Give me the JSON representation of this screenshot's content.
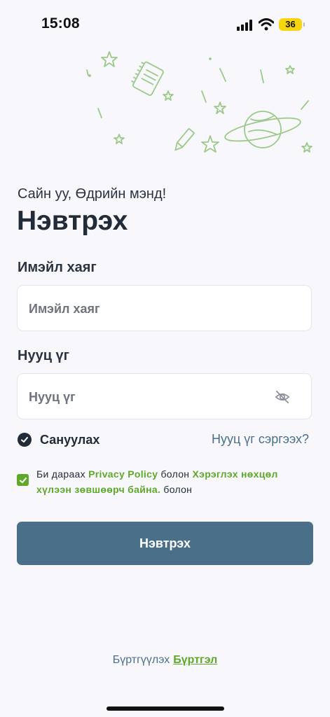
{
  "status_bar": {
    "time": "15:08",
    "battery": "36"
  },
  "login": {
    "greeting": "Сайн уу, Өдрийн мэнд!",
    "title": "Нэвтрэх",
    "email_label": "Имэйл хаяг",
    "email_placeholder": "Имэйл хаяг",
    "email_value": "",
    "password_label": "Нууц үг",
    "password_placeholder": "Нууц үг",
    "password_value": "",
    "remember_label": "Сануулах",
    "remember_checked": true,
    "forgot_link": "Нууц үг сэргээх?",
    "terms": {
      "checked": true,
      "prefix": "Би дараах",
      "privacy_link": "Privacy Policy",
      "middle": "болон",
      "terms_link": "Хэрэглэх нөхцөл хүлээн зөвшөөрч байна.",
      "suffix": "болон"
    },
    "submit_label": "Нэвтрэх",
    "register_prompt": "Бүртгүүлэх",
    "register_link": "Бүртгэл"
  },
  "colors": {
    "accent": "#4A6F88",
    "green": "#5FA82A",
    "background": "#F8F8FC",
    "text": "#222B38"
  }
}
